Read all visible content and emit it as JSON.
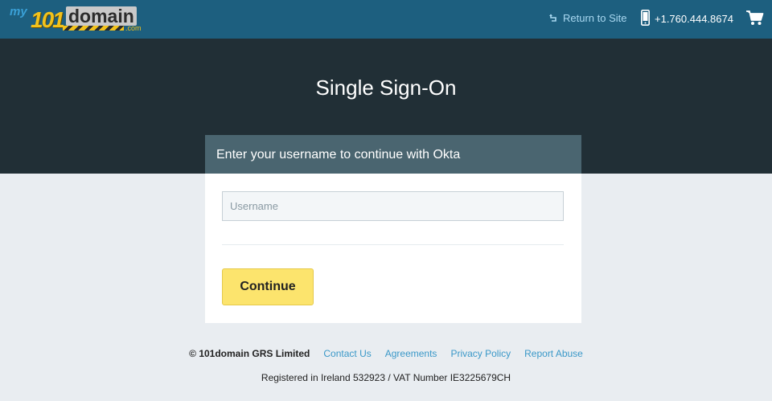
{
  "header": {
    "logo": {
      "my": "my",
      "number": "101",
      "domain": "domain",
      "tld": ".com"
    },
    "return_link": "Return to Site",
    "phone": "+1.760.444.8674",
    "icons": {
      "return": "return-arrow-icon",
      "phone": "mobile-phone-icon",
      "cart": "shopping-cart-icon"
    }
  },
  "hero": {
    "title": "Single Sign-On"
  },
  "card": {
    "header": "Enter your username to continue with Okta",
    "username_placeholder": "Username",
    "username_value": "",
    "continue_label": "Continue"
  },
  "footer": {
    "copyright": "© 101domain GRS Limited",
    "links": [
      "Contact Us",
      "Agreements",
      "Privacy Policy",
      "Report Abuse"
    ],
    "registered": "Registered in Ireland 532923 / VAT Number IE3225679CH"
  },
  "colors": {
    "topbar": "#1d5f7f",
    "hero": "#212f36",
    "card_header": "#4a6570",
    "button": "#fce46d",
    "link": "#3a98c8"
  }
}
